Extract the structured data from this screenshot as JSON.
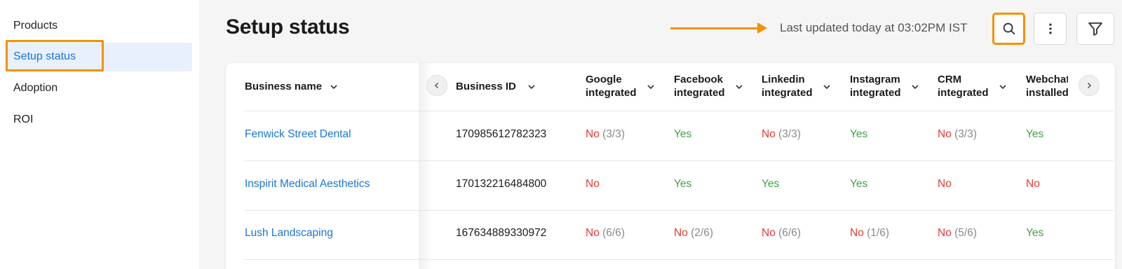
{
  "sidebar": {
    "items": [
      {
        "label": "Products",
        "active": false
      },
      {
        "label": "Setup status",
        "active": true
      },
      {
        "label": "Adoption",
        "active": false
      },
      {
        "label": "ROI",
        "active": false
      }
    ]
  },
  "header": {
    "title": "Setup status",
    "last_updated": "Last updated today at 03:02PM IST",
    "search_icon": "search-icon",
    "more_icon": "more-vertical-icon",
    "filter_icon": "filter-icon"
  },
  "colors": {
    "accent": "#1976d2",
    "highlight": "#f39200",
    "no": "#e53935",
    "yes": "#43a047"
  },
  "table": {
    "columns": [
      {
        "line1": "Business name",
        "line2": ""
      },
      {
        "line1": "Business ID",
        "line2": ""
      },
      {
        "line1": "Google",
        "line2": "integrated"
      },
      {
        "line1": "Facebook",
        "line2": "integrated"
      },
      {
        "line1": "Linkedin",
        "line2": "integrated"
      },
      {
        "line1": "Instagram",
        "line2": "integrated"
      },
      {
        "line1": "CRM",
        "line2": "integrated"
      },
      {
        "line1": "Webchat",
        "line2": "installed"
      }
    ],
    "rows": [
      {
        "business_name": "Fenwick Street Dental",
        "business_id": "170985612782323",
        "google": {
          "status": "No",
          "count": "(3/3)"
        },
        "facebook": {
          "status": "Yes",
          "count": ""
        },
        "linkedin": {
          "status": "No",
          "count": "(3/3)"
        },
        "instagram": {
          "status": "Yes",
          "count": ""
        },
        "crm": {
          "status": "No",
          "count": "(3/3)"
        },
        "webchat": {
          "status": "Yes",
          "count": ""
        }
      },
      {
        "business_name": "Inspirit Medical Aesthetics",
        "business_id": "170132216484800",
        "google": {
          "status": "No",
          "count": ""
        },
        "facebook": {
          "status": "Yes",
          "count": ""
        },
        "linkedin": {
          "status": "Yes",
          "count": ""
        },
        "instagram": {
          "status": "Yes",
          "count": ""
        },
        "crm": {
          "status": "No",
          "count": ""
        },
        "webchat": {
          "status": "No",
          "count": ""
        }
      },
      {
        "business_name": "Lush Landscaping",
        "business_id": "167634889330972",
        "google": {
          "status": "No",
          "count": "(6/6)"
        },
        "facebook": {
          "status": "No",
          "count": "(2/6)"
        },
        "linkedin": {
          "status": "No",
          "count": "(6/6)"
        },
        "instagram": {
          "status": "No",
          "count": "(1/6)"
        },
        "crm": {
          "status": "No",
          "count": "(5/6)"
        },
        "webchat": {
          "status": "Yes",
          "count": ""
        }
      }
    ]
  }
}
